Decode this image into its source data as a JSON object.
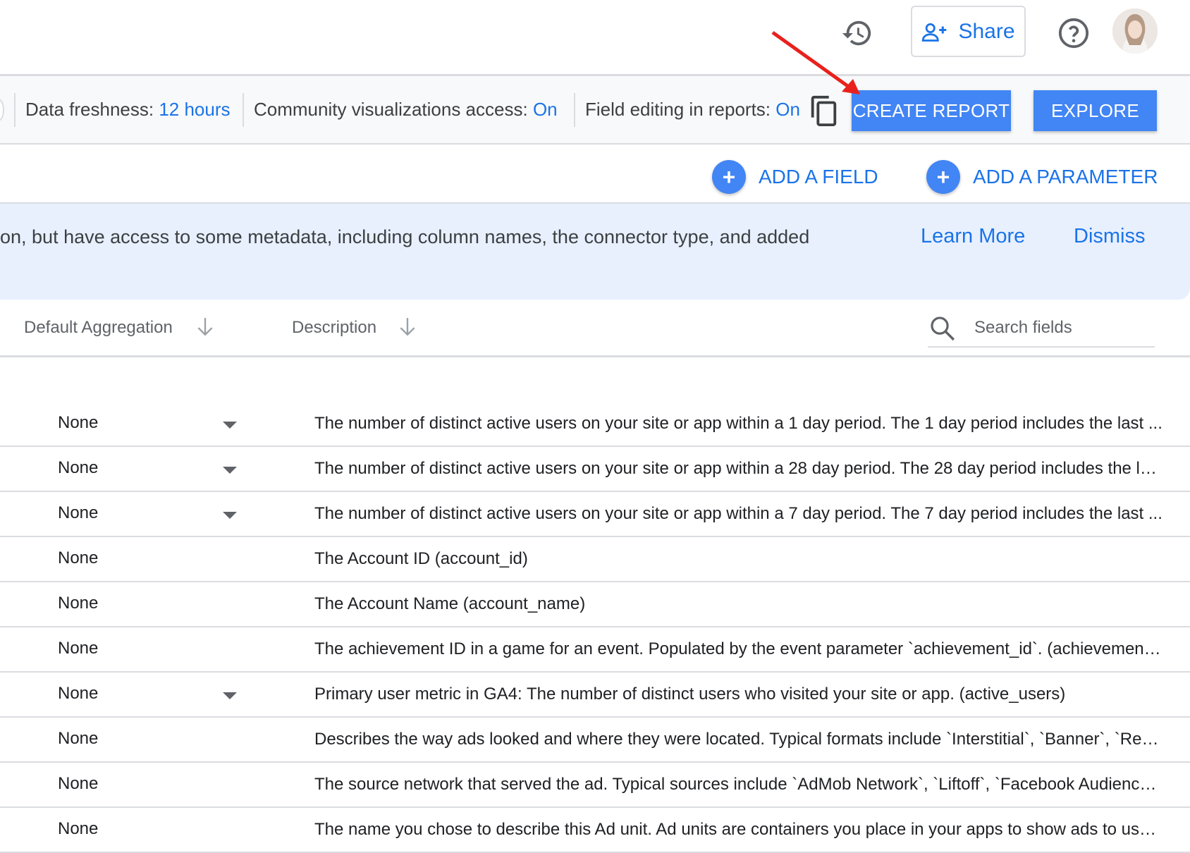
{
  "header": {
    "share_label": "Share",
    "history_icon": "history-icon",
    "help_icon": "help-icon",
    "avatar_icon": "user-avatar"
  },
  "infobar": {
    "freshness_label": "Data freshness:",
    "freshness_value": "12 hours",
    "community_label": "Community visualizations access:",
    "community_value": "On",
    "field_editing_label": "Field editing in reports:",
    "field_editing_value": "On",
    "create_report_label": "CREATE REPORT",
    "explore_label": "EXPLORE"
  },
  "actions": {
    "add_field_label": "ADD A FIELD",
    "add_parameter_label": "ADD A PARAMETER"
  },
  "banner": {
    "text": "on, but have access to some metadata, including column names, the connector type, and added",
    "learn_more": "Learn More",
    "dismiss": "Dismiss"
  },
  "columns": {
    "aggregation": "Default Aggregation",
    "description": "Description",
    "search_placeholder": "Search fields"
  },
  "rows": [
    {
      "aggregation": "None",
      "dropdown": true,
      "description": "The number of distinct active users on your site or app within a 1 day period. The 1 day period includes the last ..."
    },
    {
      "aggregation": "None",
      "dropdown": true,
      "description": "The number of distinct active users on your site or app within a 28 day period. The 28 day period includes the la..."
    },
    {
      "aggregation": "None",
      "dropdown": true,
      "description": "The number of distinct active users on your site or app within a 7 day period. The 7 day period includes the last ..."
    },
    {
      "aggregation": "None",
      "dropdown": false,
      "description": "The Account ID (account_id)"
    },
    {
      "aggregation": "None",
      "dropdown": false,
      "description": "The Account Name (account_name)"
    },
    {
      "aggregation": "None",
      "dropdown": false,
      "description": "The achievement ID in a game for an event. Populated by the event parameter `achievement_id`. (achievement_i..."
    },
    {
      "aggregation": "None",
      "dropdown": true,
      "description": "Primary user metric in GA4: The number of distinct users who visited your site or app. (active_users)"
    },
    {
      "aggregation": "None",
      "dropdown": false,
      "description": "Describes the way ads looked and where they were located. Typical formats include `Interstitial`, `Banner`, `Rew..."
    },
    {
      "aggregation": "None",
      "dropdown": false,
      "description": "The source network that served the ad. Typical sources include `AdMob Network`, `Liftoff`, `Facebook Audience ..."
    },
    {
      "aggregation": "None",
      "dropdown": false,
      "description": "The name you chose to describe this Ad unit. Ad units are containers you place in your apps to show ads to user..."
    }
  ],
  "colors": {
    "accent": "#1a73e8",
    "button": "#4285f4",
    "banner_bg": "#e8f0fe",
    "annotation_arrow": "#e8211c"
  }
}
